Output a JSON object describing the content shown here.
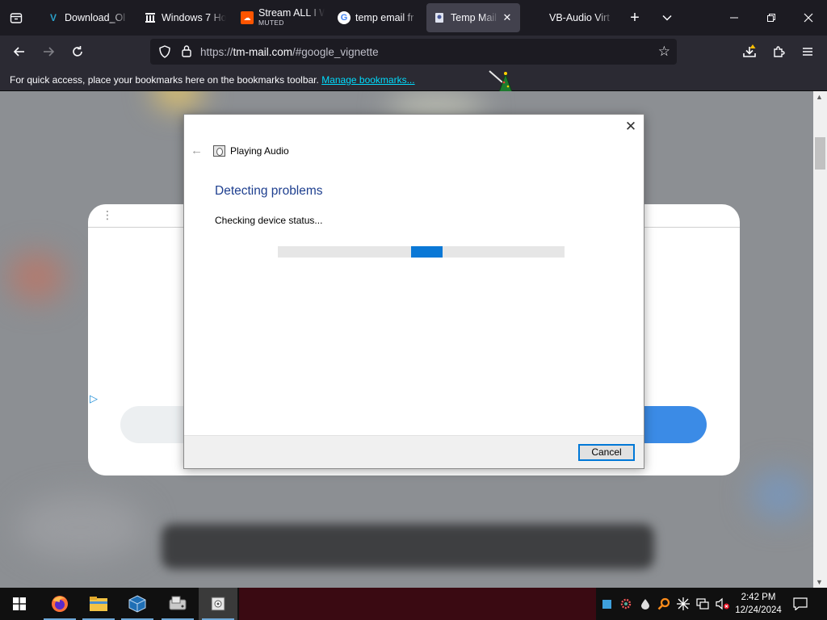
{
  "browser": {
    "tabs": [
      {
        "title": "Download_Ol",
        "favicon": "vb-logo-icon",
        "active": false
      },
      {
        "title": "Windows 7 Ho",
        "favicon": "library-icon",
        "active": false
      },
      {
        "title": "Stream ALL I W",
        "subtitle": "MUTED",
        "favicon": "soundcloud-icon",
        "active": false
      },
      {
        "title": "temp email fr",
        "favicon": "google-icon",
        "active": false
      },
      {
        "title": "Temp Mail",
        "favicon": "tempmail-icon",
        "active": true
      },
      {
        "title": "VB-Audio Virt",
        "favicon": "",
        "active": false
      }
    ],
    "url_prefix": "https://",
    "url_domain": "tm-mail.com",
    "url_path": "/#google_vignette",
    "bookmarks_message": "For quick access, place your bookmarks here on the bookmarks toolbar.",
    "bookmarks_link": "Manage bookmarks..."
  },
  "dialog": {
    "app_title": "Playing Audio",
    "heading": "Detecting problems",
    "status": "Checking device status...",
    "progress_indeterminate_position": 0.52,
    "cancel_label": "Cancel"
  },
  "taskbar": {
    "pinned": [
      "start-icon",
      "firefox-icon",
      "file-explorer-icon",
      "virtualbox-icon",
      "disk-cleanup-icon",
      "troubleshooter-icon"
    ],
    "clock_time": "2:42 PM",
    "clock_date": "12/24/2024"
  },
  "colors": {
    "accent": "#0078d7",
    "dialog_heading": "#1e3f8f",
    "browser_bg": "#1c1b22",
    "link": "#00ddff"
  }
}
